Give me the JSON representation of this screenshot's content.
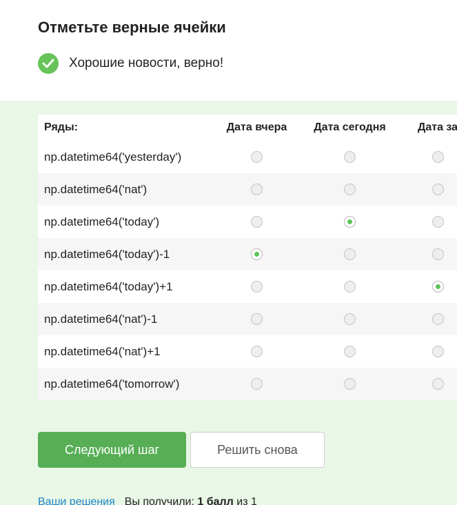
{
  "title": "Отметьте верные ячейки",
  "status": {
    "icon": "check-circle-icon",
    "text": "Хорошие новости, верно!",
    "color": "#66c459"
  },
  "table": {
    "rows_header": "Ряды:",
    "columns": [
      "Дата вчера",
      "Дата сегодня",
      "Дата за"
    ],
    "rows": [
      {
        "label": "np.datetime64('yesterday')",
        "selected": null
      },
      {
        "label": "np.datetime64('nat')",
        "selected": null
      },
      {
        "label": "np.datetime64('today')",
        "selected": 1
      },
      {
        "label": "np.datetime64('today')-1",
        "selected": 0
      },
      {
        "label": "np.datetime64('today')+1",
        "selected": 2
      },
      {
        "label": "np.datetime64('nat')-1",
        "selected": null
      },
      {
        "label": "np.datetime64('nat')+1",
        "selected": null
      },
      {
        "label": "np.datetime64('tomorrow')",
        "selected": null
      }
    ]
  },
  "buttons": {
    "next": "Следующий шаг",
    "retry": "Решить снова"
  },
  "footer": {
    "solutions_link": "Ваши решения",
    "score_prefix": "Вы получили:",
    "score_value": "1 балл",
    "score_suffix": "из 1"
  },
  "colors": {
    "accent": "#57ae55",
    "panel": "#e9f7e6",
    "link": "#1f84c7",
    "radio_dot": "#5cc659"
  }
}
